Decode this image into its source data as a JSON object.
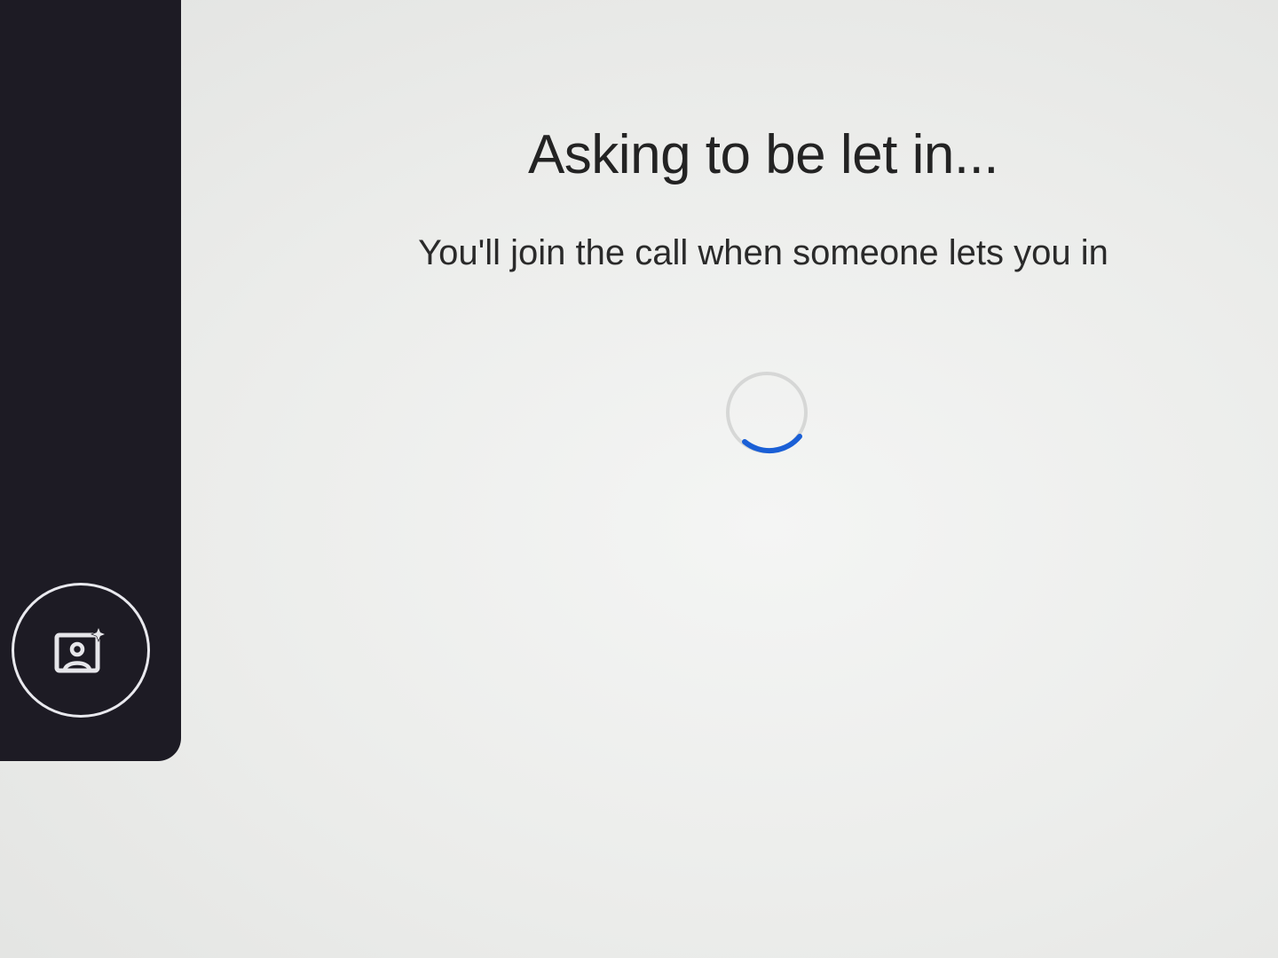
{
  "waiting_screen": {
    "title": "Asking to be let in...",
    "message": "You'll join the call when someone lets you in",
    "spinner_icon": "loading-spinner-icon",
    "spinner_color": "#1a5fd6"
  },
  "self_preview": {
    "effects_button_icon": "visual-effects-icon",
    "background_color": "#1d1b24"
  }
}
